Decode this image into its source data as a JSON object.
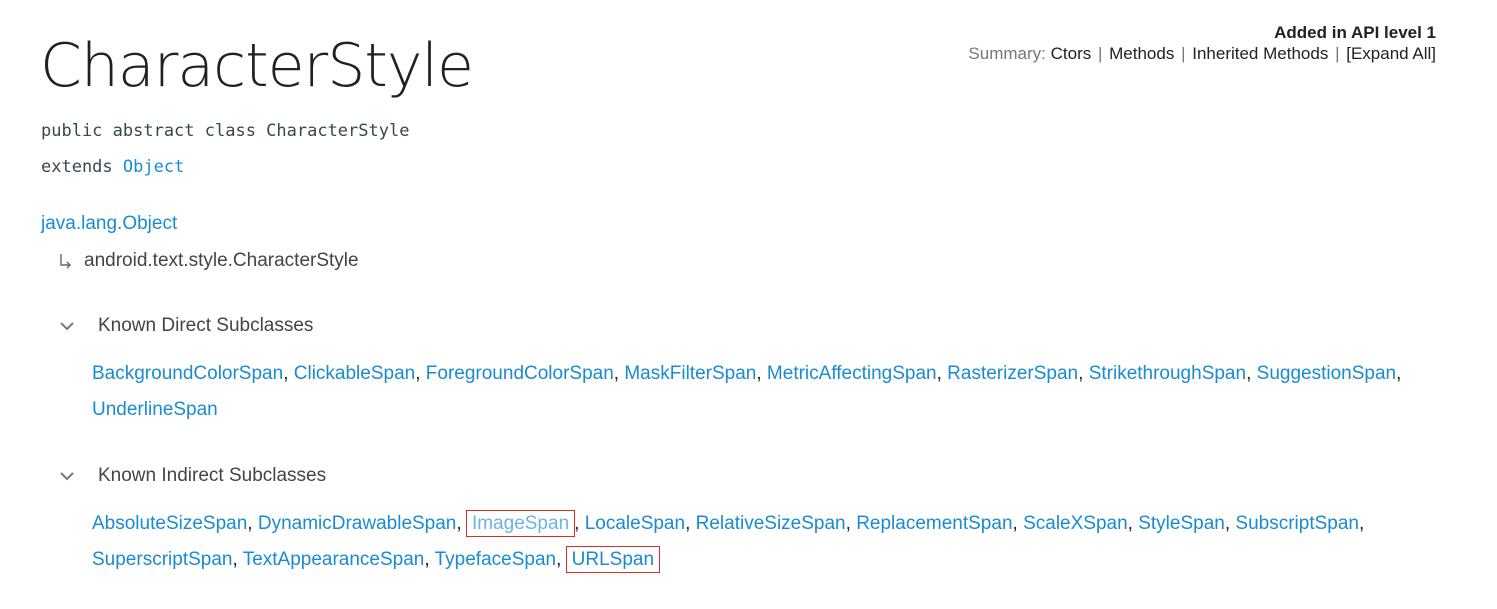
{
  "page": {
    "title": "CharacterStyle",
    "signature": "public abstract class CharacterStyle",
    "extends_keyword": "extends",
    "extends_class": "Object"
  },
  "meta": {
    "api_level": "Added in API level 1",
    "summary_label": "Summary:",
    "links": [
      "Ctors",
      "Methods",
      "Inherited Methods",
      "[Expand All]"
    ],
    "separator": "|"
  },
  "hierarchy": {
    "root": "java.lang.Object",
    "child": "android.text.style.CharacterStyle"
  },
  "direct_subclasses": {
    "heading": "Known Direct Subclasses",
    "items": [
      "BackgroundColorSpan",
      "ClickableSpan",
      "ForegroundColorSpan",
      "MaskFilterSpan",
      "MetricAffectingSpan",
      "RasterizerSpan",
      "StrikethroughSpan",
      "SuggestionSpan",
      "UnderlineSpan"
    ]
  },
  "indirect_subclasses": {
    "heading": "Known Indirect Subclasses",
    "items": [
      "AbsoluteSizeSpan",
      "DynamicDrawableSpan",
      "ImageSpan",
      "LocaleSpan",
      "RelativeSizeSpan",
      "ReplacementSpan",
      "ScaleXSpan",
      "StyleSpan",
      "SubscriptSpan",
      "SuperscriptSpan",
      "TextAppearanceSpan",
      "TypefaceSpan",
      "URLSpan"
    ],
    "highlighted": [
      "ImageSpan",
      "URLSpan"
    ]
  },
  "colors": {
    "link": "#1a8bd1",
    "highlight_box": "#d93025",
    "text": "#202124",
    "muted": "#777777"
  }
}
